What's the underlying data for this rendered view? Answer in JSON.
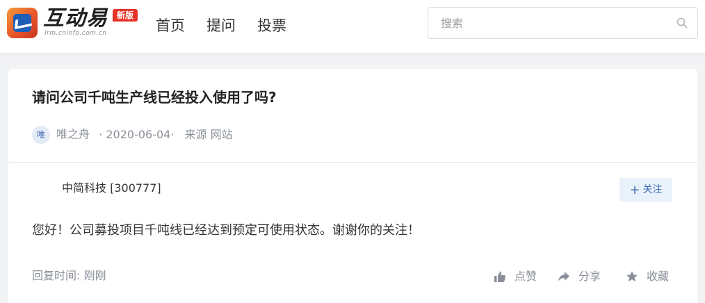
{
  "header": {
    "logo": {
      "name": "互动易",
      "domain": "irm.cninfo.com.cn",
      "badge": "新版"
    },
    "nav": [
      {
        "label": "首页"
      },
      {
        "label": "提问"
      },
      {
        "label": "投票"
      }
    ],
    "search": {
      "placeholder": "搜索",
      "value": ""
    }
  },
  "question": {
    "title": "请问公司千吨生产线已经投入使用了吗?",
    "avatar_text": "唯",
    "author": "唯之舟",
    "date": "· 2020-06-04·",
    "source": "来源 网站"
  },
  "answer": {
    "company": "中简科技 [300777]",
    "follow_label": "关注",
    "text": "您好！公司募投项目千吨线已经达到预定可使用状态。谢谢你的关注！",
    "reply_time_label": "回复时间:",
    "reply_time_value": "刚刚",
    "actions": [
      {
        "label": "点赞",
        "icon": "thumbs-up-icon"
      },
      {
        "label": "分享",
        "icon": "share-icon"
      },
      {
        "label": "收藏",
        "icon": "star-icon"
      }
    ]
  },
  "colors": {
    "accent": "#3d6db5",
    "badge": "#e5332a",
    "muted": "#8a8f99",
    "background": "#f2f3f5"
  }
}
